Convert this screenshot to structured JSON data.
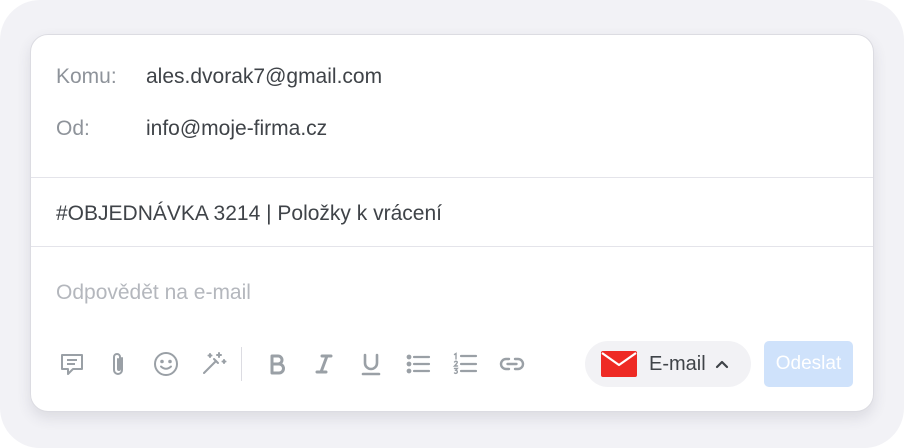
{
  "header": {
    "to_label": "Komu:",
    "to_value": "ales.dvorak7@gmail.com",
    "from_label": "Od:",
    "from_value": "info@moje-firma.cz"
  },
  "subject": "#OBJEDNÁVKA 3214 | Položky k vrácení",
  "body": {
    "placeholder": "Odpovědět na e-mail",
    "value": ""
  },
  "toolbar": {
    "icons": [
      "template-icon",
      "attachment-icon",
      "emoji-icon",
      "magic-wand-icon",
      "bold-icon",
      "italic-icon",
      "underline-icon",
      "bullet-list-icon",
      "numbered-list-icon",
      "link-icon"
    ],
    "icon_color": "#9aa0a6"
  },
  "channel": {
    "label": "E-mail",
    "icon": "envelope-icon",
    "icon_color": "#ee2a24"
  },
  "send_label": "Odeslat",
  "colors": {
    "send_button": "#cfe2fb",
    "channel_bg": "#f2f2f5"
  }
}
